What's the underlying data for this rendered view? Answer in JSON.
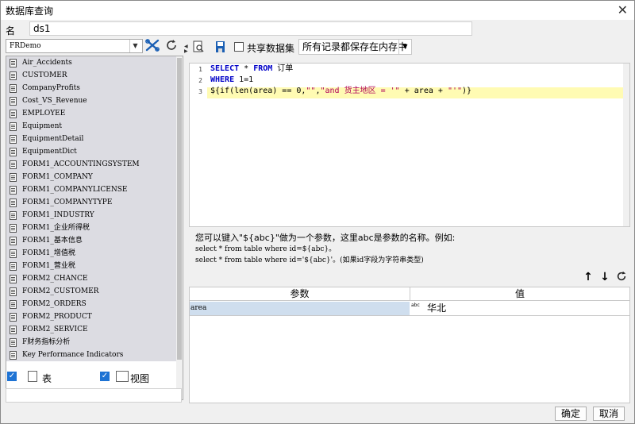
{
  "window": {
    "title": "数据库查询",
    "close_glyph": "✕"
  },
  "name_field": {
    "label": "名字:",
    "value": "ds1"
  },
  "left_panel": {
    "datasource": "FRDemo",
    "tables": [
      "Air_Accidents",
      "CUSTOMER",
      "CompanyProfits",
      "Cost_VS_Revenue",
      "EMPLOYEE",
      "Equipment",
      "EquipmentDetail",
      "EquipmentDict",
      "FORM1_ACCOUNTINGSYSTEM",
      "FORM1_COMPANY",
      "FORM1_COMPANYLICENSE",
      "FORM1_COMPANYTYPE",
      "FORM1_INDUSTRY",
      "FORM1_企业所得税",
      "FORM1_基本信息",
      "FORM1_增值税",
      "FORM1_营业税",
      "FORM2_CHANCE",
      "FORM2_CUSTOMER",
      "FORM2_ORDERS",
      "FORM2_PRODUCT",
      "FORM2_SERVICE",
      "F财务指标分析",
      "Key Performance Indicators"
    ],
    "filters": {
      "table_label": "表",
      "view_label": "视图",
      "table_checked": true,
      "view_checked": true
    }
  },
  "right_toolbar": {
    "share_label": "共享数据集",
    "save_option": "所有记录都保存在内存中"
  },
  "editor": {
    "line_numbers": [
      "1",
      "2",
      "3"
    ],
    "line1": {
      "kw1": "SELECT",
      "star": " * ",
      "kw2": "FROM",
      "rest": " 订单"
    },
    "line2": {
      "kw": "WHERE",
      "rest": " 1=1"
    },
    "line3": {
      "a": "${if(len(area) == 0,",
      "b": "\"\"",
      "c": ",",
      "d": "\"and 货主地区 = '\"",
      "e": " + area + ",
      "f": "\"'\"",
      "g": ")}"
    }
  },
  "hint": {
    "line1": "您可以键入\"${abc}\"做为一个参数，这里abc是参数的名称。例如:",
    "line2": "select * from table where id=${abc}。",
    "line3": "select * from table where id='${abc}'。(如果id字段为字符串类型)"
  },
  "params": {
    "col_name": "参数",
    "col_value": "值",
    "rows": [
      {
        "name": "area",
        "type": "abc",
        "value": "华北"
      }
    ]
  },
  "buttons": {
    "ok": "确定",
    "cancel": "取消"
  },
  "colors": {
    "keyword": "#0000c8",
    "string": "#b0005a",
    "highlight": "#fffbb3",
    "selected_row": "#cfdeee",
    "checkbox": "#1e73d4"
  }
}
